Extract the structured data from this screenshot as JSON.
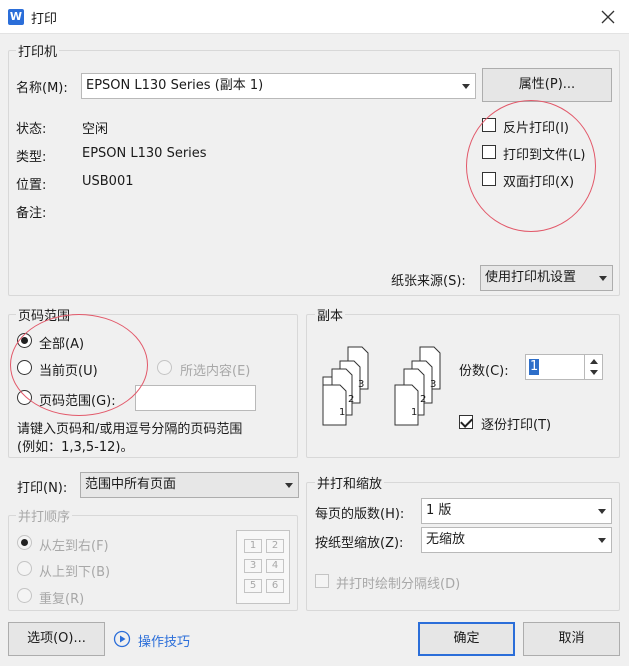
{
  "title": "打印",
  "app_icon_letter": "W",
  "printer": {
    "group_label": "打印机",
    "name_label": "名称(M):",
    "name_value": "EPSON L130 Series (副本 1)",
    "properties_button": "属性(P)...",
    "status_label": "状态:",
    "status_value": "空闲",
    "type_label": "类型:",
    "type_value": "EPSON L130 Series",
    "location_label": "位置:",
    "location_value": "USB001",
    "comment_label": "备注:",
    "reverse_print": "反片打印(I)",
    "print_to_file": "打印到文件(L)",
    "duplex": "双面打印(X)",
    "paper_source_label": "纸张来源(S):",
    "paper_source_value": "使用打印机设置"
  },
  "page_range": {
    "group_label": "页码范围",
    "all": "全部(A)",
    "current": "当前页(U)",
    "selection": "所选内容(E)",
    "pages": "页码范围(G):",
    "pages_value": "",
    "hint_line1": "请键入页码和/或用逗号分隔的页码范围",
    "hint_line2": "(例如：1,3,5-12)。"
  },
  "copies": {
    "group_label": "副本",
    "count_label": "份数(C):",
    "count_value": "1",
    "collate": "逐份打印(T)",
    "collate_checked": true,
    "stack_labels": [
      "1",
      "2",
      "3"
    ]
  },
  "print_what": {
    "label": "打印(N):",
    "value": "范围中所有页面"
  },
  "order": {
    "group_label": "并打顺序",
    "left_to_right": "从左到右(F)",
    "top_to_bottom": "从上到下(B)",
    "repeat": "重复(R)",
    "grid_labels": [
      "1",
      "2",
      "3",
      "4",
      "5",
      "6"
    ]
  },
  "zoom": {
    "group_label": "并打和缩放",
    "pages_per_sheet_label": "每页的版数(H):",
    "pages_per_sheet_value": "1 版",
    "scale_label": "按纸型缩放(Z):",
    "scale_value": "无缩放",
    "draw_lines": "并打时绘制分隔线(D)"
  },
  "footer": {
    "options_button": "选项(O)...",
    "tips_link": "操作技巧",
    "ok_button": "确定",
    "cancel_button": "取消"
  },
  "colors": {
    "accent": "#2b6ed9",
    "highlight_circle": "#e2596a"
  }
}
